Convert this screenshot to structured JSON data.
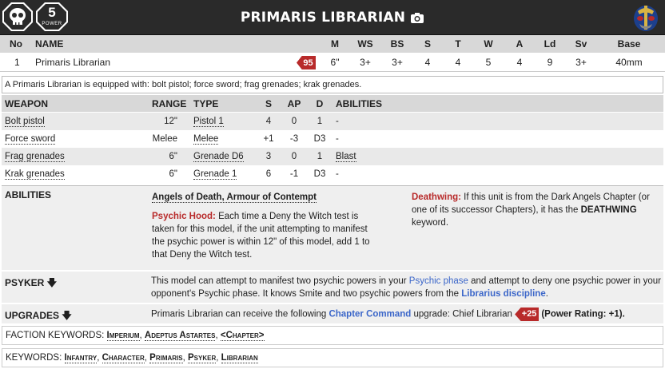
{
  "header": {
    "title": "PRIMARIS LIBRARIAN",
    "power_rating": "5",
    "power_label": "POWER",
    "icons": [
      "skull-icon",
      "camera-icon",
      "helmet-icon"
    ]
  },
  "stats": {
    "columns": [
      "No",
      "NAME",
      "M",
      "WS",
      "BS",
      "S",
      "T",
      "W",
      "A",
      "Ld",
      "Sv",
      "Base"
    ],
    "row": {
      "no": "1",
      "name": "Primaris Librarian",
      "points": "95",
      "m": "6\"",
      "ws": "3+",
      "bs": "3+",
      "s": "4",
      "t": "4",
      "w": "5",
      "a": "4",
      "ld": "9",
      "sv": "3+",
      "base": "40mm"
    }
  },
  "equipment": "A Primaris Librarian is equipped with: bolt pistol; force sword; frag grenades; krak grenades.",
  "weapons": {
    "columns": [
      "WEAPON",
      "RANGE",
      "TYPE",
      "S",
      "AP",
      "D",
      "ABILITIES"
    ],
    "rows": [
      {
        "name": "Bolt pistol",
        "range": "12\"",
        "type": "Pistol 1",
        "s": "4",
        "ap": "0",
        "d": "1",
        "abilities": "-"
      },
      {
        "name": "Force sword",
        "range": "Melee",
        "type": "Melee",
        "s": "+1",
        "ap": "-3",
        "d": "D3",
        "abilities": "-"
      },
      {
        "name": "Frag grenades",
        "range": "6\"",
        "type": "Grenade D6",
        "s": "3",
        "ap": "0",
        "d": "1",
        "abilities": "Blast"
      },
      {
        "name": "Krak grenades",
        "range": "6\"",
        "type": "Grenade 1",
        "s": "6",
        "ap": "-1",
        "d": "D3",
        "abilities": "-"
      }
    ]
  },
  "abilities": {
    "label": "ABILITIES",
    "core": "Angels of Death, Armour of Contempt",
    "psychic_hood_title": "Psychic Hood:",
    "psychic_hood_text": " Each time a Deny the Witch test is taken for this model, if the unit attempting to manifest the psychic power is within 12\" of this model, add 1 to that Deny the Witch test.",
    "deathwing_title": "Deathwing:",
    "deathwing_text_1": " If this unit is from the Dark Angels Chapter (or one of its successor Chapters), it has the ",
    "deathwing_keyword": "DEATHWING",
    "deathwing_text_2": " keyword."
  },
  "psyker": {
    "label": "PSYKER",
    "text_1": "This model can attempt to manifest two psychic powers in your ",
    "link_1": "Psychic phase",
    "text_2": " and attempt to deny one psychic power in your opponent's Psychic phase. It knows Smite and two psychic powers from the ",
    "link_2": "Librarius discipline",
    "text_3": "."
  },
  "upgrades": {
    "label": "UPGRADES",
    "text_1": "Primaris Librarian can receive the following ",
    "link": "Chapter Command",
    "text_2": " upgrade: Chief Librarian",
    "points": "+25",
    "power_note": "(Power Rating: +1)."
  },
  "faction_keywords": {
    "label": "FACTION KEYWORDS:",
    "values": [
      "Imperium",
      "Adeptus Astartes",
      "<Chapter>"
    ]
  },
  "keywords": {
    "label": "KEYWORDS:",
    "values": [
      "Infantry",
      "Character",
      "Primaris",
      "Psyker",
      "Librarian"
    ]
  },
  "colors": {
    "header_bg": "#2a2a2a",
    "accent_red": "#b82a2a",
    "link_blue": "#3b66c9",
    "table_head_bg": "#d8d8d8"
  }
}
